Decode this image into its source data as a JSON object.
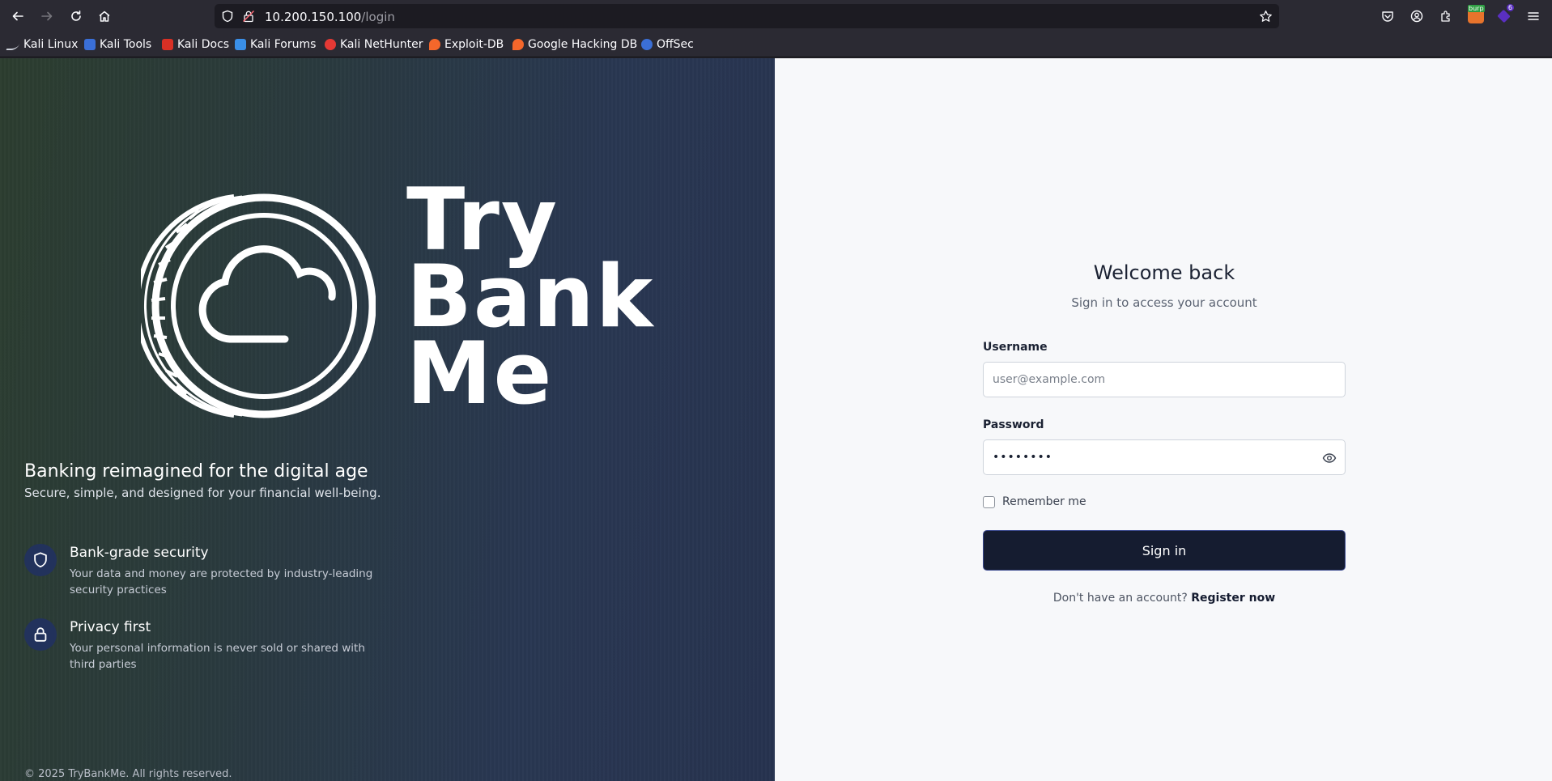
{
  "browser": {
    "url_host": "10.200.150.100",
    "url_path": "/login",
    "bookmarks": [
      {
        "label": "Kali Linux",
        "color": "#2f80ed"
      },
      {
        "label": "Kali Tools",
        "color": "#3a6fd8"
      },
      {
        "label": "Kali Docs",
        "color": "#d93025"
      },
      {
        "label": "Kali Forums",
        "color": "#3a8fe8"
      },
      {
        "label": "Kali NetHunter",
        "color": "#e53935"
      },
      {
        "label": "Exploit-DB",
        "color": "#f4672b"
      },
      {
        "label": "Google Hacking DB",
        "color": "#f4672b"
      },
      {
        "label": "OffSec",
        "color": "#3b6fd6"
      }
    ],
    "extensions": {
      "burp_label": "burp",
      "ext_badge": "6"
    }
  },
  "hero": {
    "logo_lines": [
      "Try",
      "Bank",
      "Me"
    ],
    "tagline_title": "Banking reimagined for the digital age",
    "tagline_sub": "Secure, simple, and designed for your financial well-being.",
    "features": [
      {
        "icon": "shield-icon",
        "title": "Bank-grade security",
        "desc": "Your data and money are protected by industry-leading security practices"
      },
      {
        "icon": "lock-icon",
        "title": "Privacy first",
        "desc": "Your personal information is never sold or shared with third parties"
      }
    ],
    "copyright": "© 2025 TryBankMe. All rights reserved."
  },
  "login": {
    "title": "Welcome back",
    "subtitle": "Sign in to access your account",
    "username_label": "Username",
    "username_placeholder": "user@example.com",
    "password_label": "Password",
    "password_value": "••••••••",
    "remember_label": "Remember me",
    "submit_label": "Sign in",
    "register_prompt": "Don't have an account?",
    "register_link": "Register now"
  },
  "colors": {
    "accent": "#151c30",
    "hero_green": "#2c3d2f",
    "hero_blue": "#27334f",
    "icon_badge": "#22325c"
  }
}
